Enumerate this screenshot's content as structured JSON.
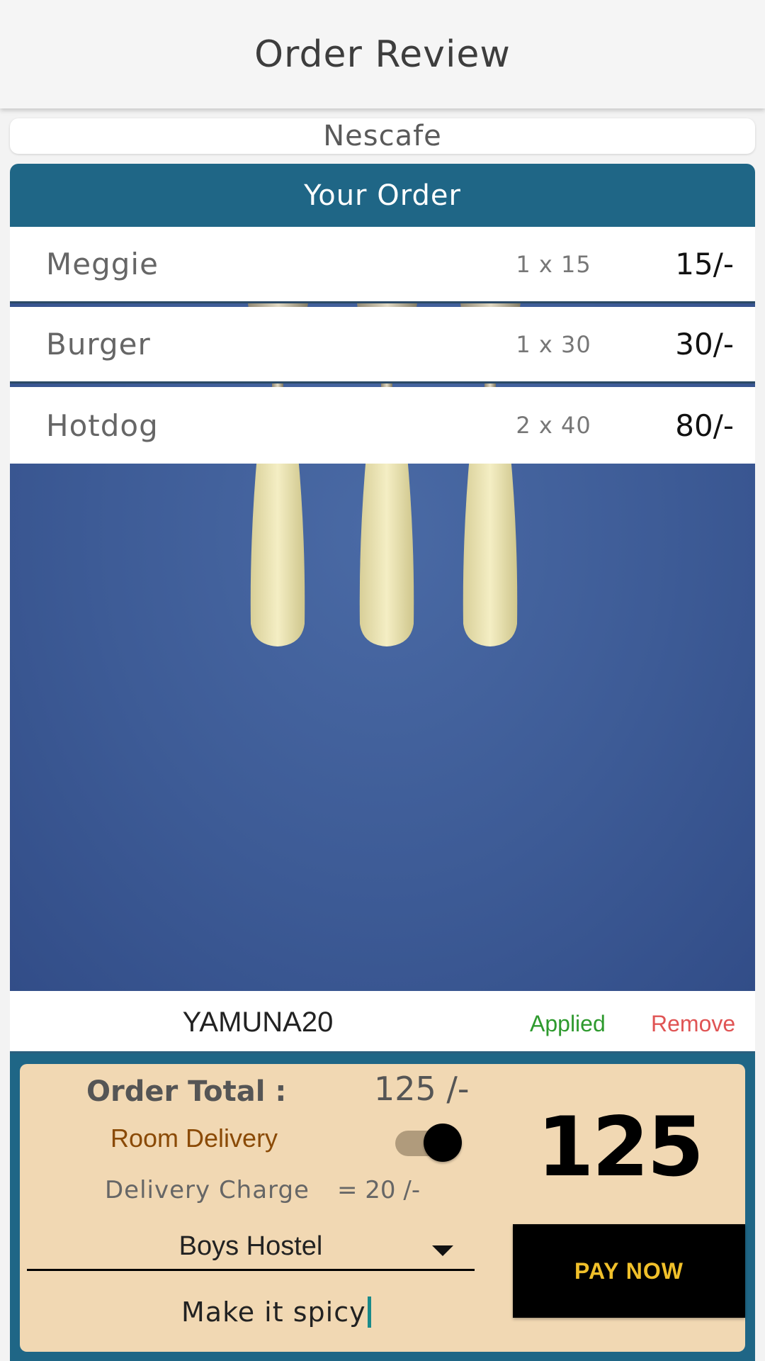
{
  "appbar": {
    "title": "Order Review"
  },
  "restaurant": {
    "name": "Nescafe"
  },
  "order": {
    "header": "Your Order",
    "items": [
      {
        "name": "Meggie",
        "qty": "1 x 15",
        "total": "15/-"
      },
      {
        "name": "Burger",
        "qty": "1 x 30",
        "total": "30/-"
      },
      {
        "name": "Hotdog",
        "qty": "2 x 40",
        "total": "80/-"
      }
    ]
  },
  "coupon": {
    "code": "YAMUNA20",
    "status": "Applied",
    "remove_label": "Remove"
  },
  "checkout": {
    "total_label": "Order Total :",
    "total_value": "125 /-",
    "delivery_label": "Room Delivery",
    "delivery_enabled": true,
    "charge_label": "Delivery Charge",
    "charge_value": "= 20 /-",
    "grand_total": "125",
    "location": "Boys Hostel",
    "pay_label": "PAY NOW",
    "note": "Make it spicy"
  },
  "colors": {
    "header_blue": "#1f6686",
    "checkout_bg": "#f1d8b3",
    "pay_text": "#f0c02a",
    "applied": "#2e9a2e",
    "remove": "#e05454",
    "delivery_text": "#8a4a06"
  },
  "icons": {
    "dropdown": "caret-down-icon",
    "photo": "three-forks-photo"
  }
}
